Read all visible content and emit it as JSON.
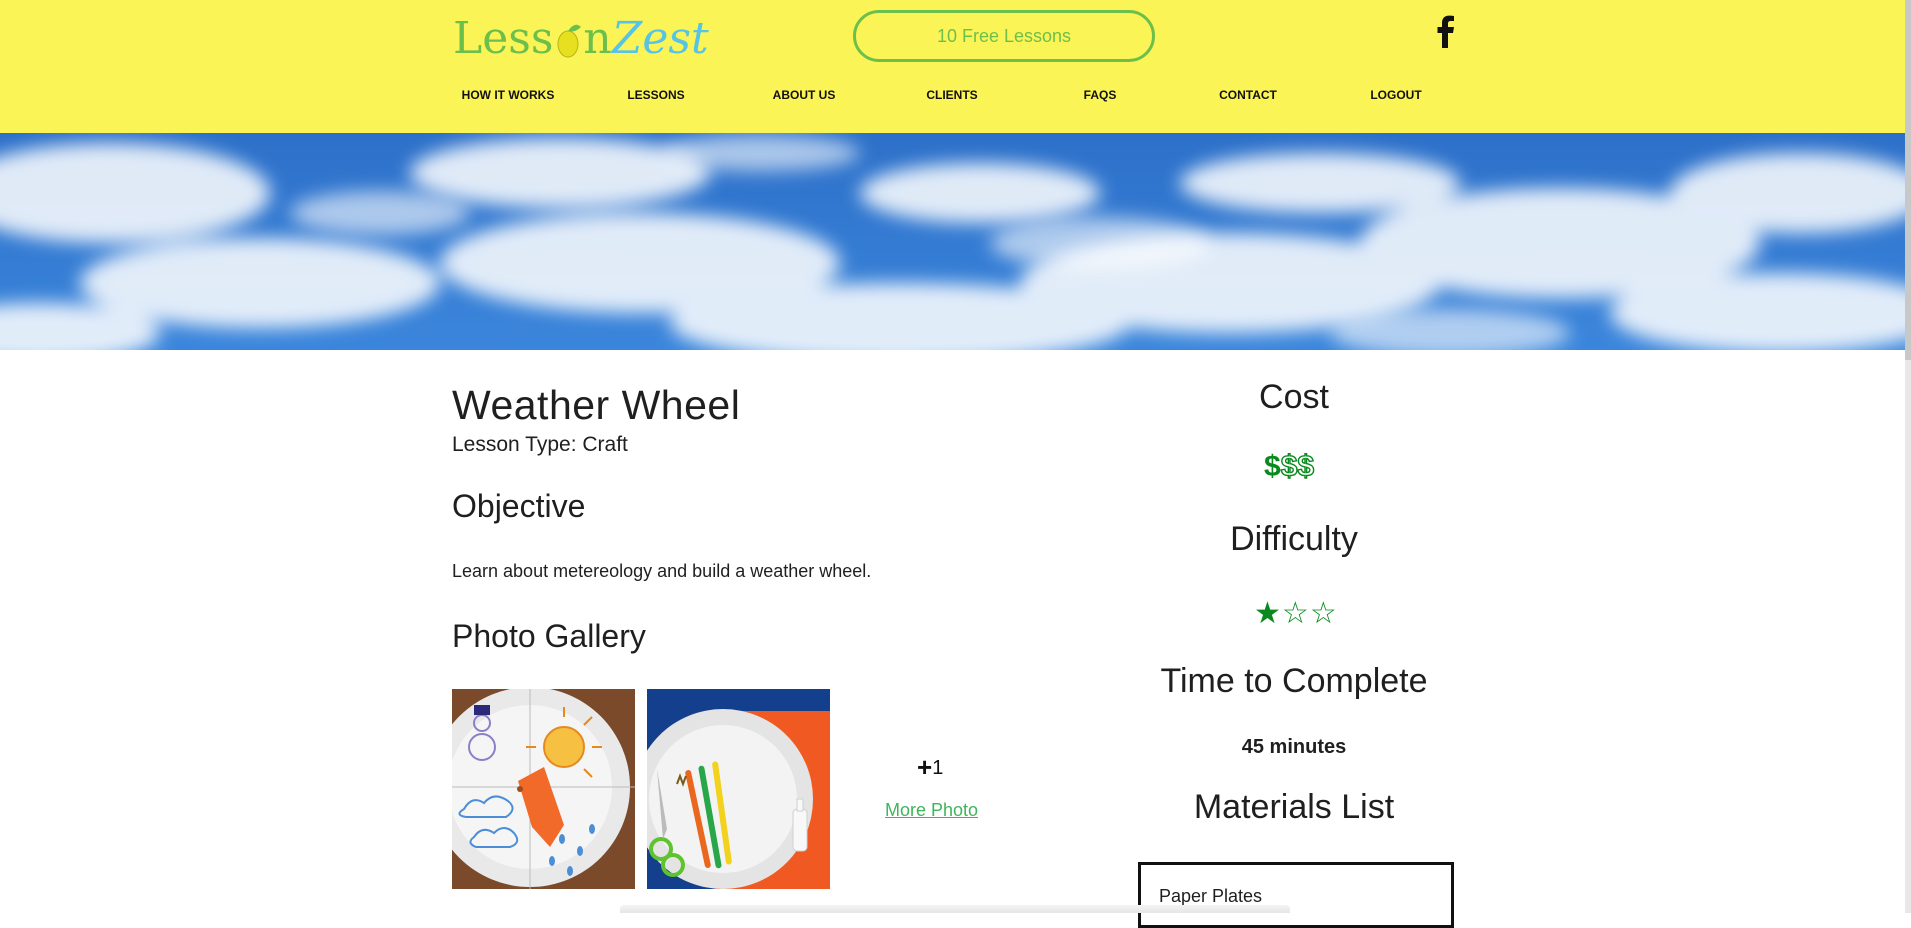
{
  "header": {
    "logo_part1": "Less",
    "logo_part2": "n",
    "logo_part3": "Zest",
    "free_lessons_label": "10 Free Lessons",
    "facebook_icon": "facebook-icon",
    "nav": [
      "HOW IT WORKS",
      "LESSONS",
      "ABOUT US",
      "CLIENTS",
      "FAQS",
      "CONTACT",
      "LOGOUT"
    ]
  },
  "lesson": {
    "title": "Weather Wheel",
    "lesson_type": "Lesson Type: Craft",
    "objective_heading": "Objective",
    "objective_text": "Learn about metereology and build a weather wheel.",
    "gallery_heading": "Photo Gallery",
    "extra_count": "1",
    "more_photo_label": "More Photo"
  },
  "sidebar": {
    "cost_heading": "Cost",
    "cost_level": 1,
    "cost_max": 3,
    "difficulty_heading": "Difficulty",
    "difficulty_level": 1,
    "difficulty_max": 3,
    "time_heading": "Time to Complete",
    "time_value": "45 minutes",
    "materials_heading": "Materials List",
    "materials": [
      "Paper Plates"
    ]
  },
  "colors": {
    "header_bg": "#fbf456",
    "accent_green": "#6cbf4a",
    "link_green": "#3fb55a",
    "rating_green": "#0a8a1e",
    "logo_blue": "#55c4e6"
  }
}
